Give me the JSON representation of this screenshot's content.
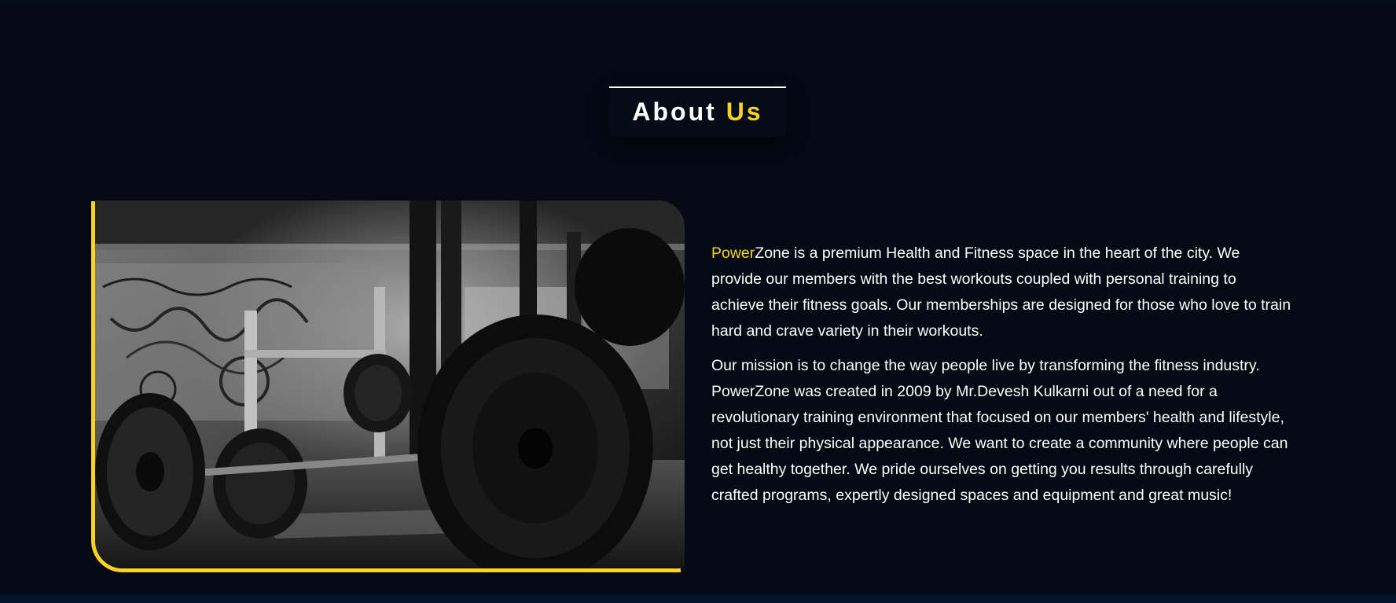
{
  "section": {
    "title_main": "About",
    "title_accent": "Us"
  },
  "about": {
    "brand_highlight": "Power",
    "paragraph1_rest": "Zone is a premium Health and Fitness space in the heart of the city. We provide our members with the best workouts coupled with personal training to achieve their fitness goals. Our memberships are designed for those who love to train hard and crave variety in their workouts.",
    "paragraph2": "Our mission is to change the way people live by transforming the fitness industry. PowerZone was created in 2009 by Mr.Devesh Kulkarni out of a need for a revolutionary training environment that focused on our members' health and lifestyle, not just their physical appearance. We want to create a community where people can get healthy together. We pride ourselves on getting you results through carefully crafted programs, expertly designed spaces and equipment and great music!"
  },
  "photo": {
    "icon": "gym-barbell-photo"
  },
  "colors": {
    "background": "#030a14",
    "accent": "#f9d31c",
    "text": "#ffffff",
    "footer_strip": "#03132b"
  }
}
